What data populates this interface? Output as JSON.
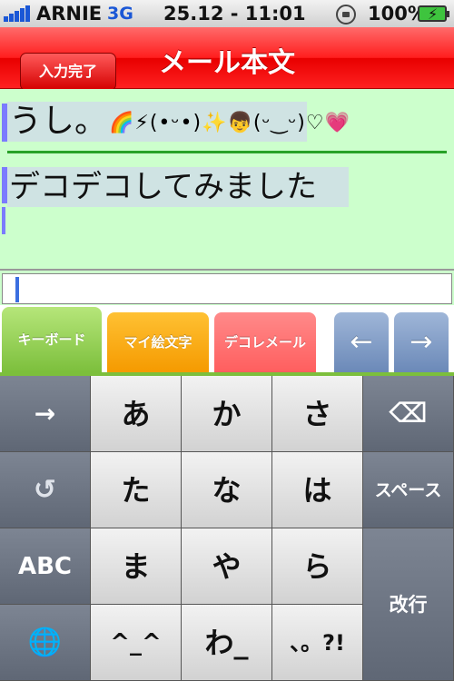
{
  "status_bar": {
    "carrier": "ARNIE",
    "network": "3G",
    "datetime": "25.12 - 11:01",
    "battery": "100%"
  },
  "nav": {
    "back_label": "入力完了",
    "title": "メール本文"
  },
  "mail": {
    "subject": "うし。",
    "emoji_strip": "🌈⚡(•ᵕ•)✨👦(ᵕ‿ᵕ)♡💗",
    "body": "デコデコしてみました"
  },
  "input": {
    "value": ""
  },
  "tabs": {
    "keyboard": "キーボード",
    "my_emoji": "マイ絵文字",
    "deco_mail": "デコレメール",
    "left_arrow": "←",
    "right_arrow": "→"
  },
  "keyboard": {
    "row1": [
      "→",
      "あ",
      "か",
      "さ",
      "⌫"
    ],
    "row2": [
      "↺",
      "た",
      "な",
      "は",
      "スペース"
    ],
    "row3": [
      "ABC",
      "ま",
      "や",
      "ら"
    ],
    "row4": [
      "🌐",
      "^_^",
      "わ_",
      "、。?!"
    ],
    "return": "改行"
  }
}
